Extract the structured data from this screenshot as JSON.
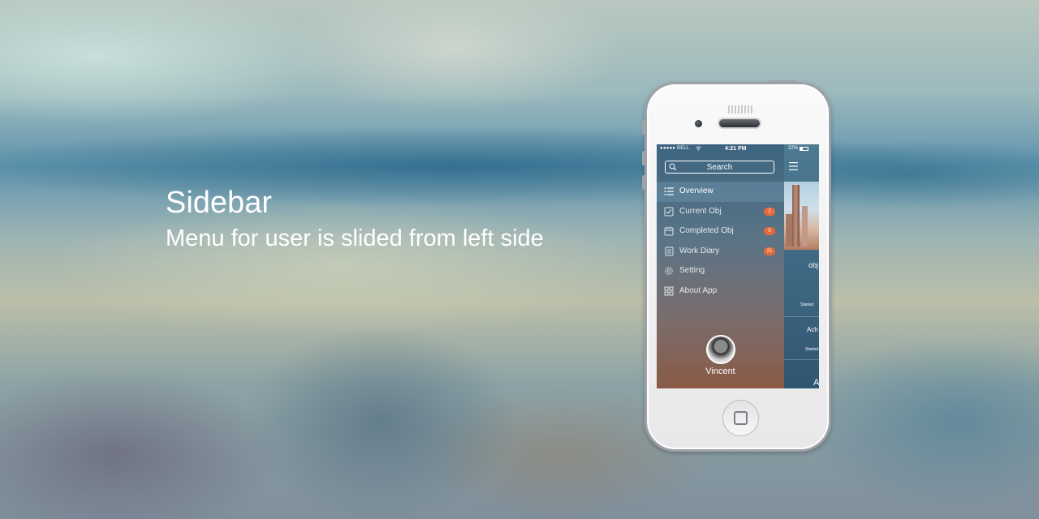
{
  "caption": {
    "title": "Sidebar",
    "subtitle": "Menu for user is slided from left side"
  },
  "status_bar": {
    "carrier": "●●●●● BELL",
    "time": "4:21 PM",
    "battery": "22%"
  },
  "search": {
    "label": "Search"
  },
  "menu": {
    "items": [
      {
        "label": "Overview",
        "icon": "list-icon",
        "active": true
      },
      {
        "label": "Current Obj",
        "icon": "checklist-icon",
        "badge": "2"
      },
      {
        "label": "Completed Obj",
        "icon": "calendar-icon",
        "badge": "0"
      },
      {
        "label": "Work Diary",
        "icon": "notebook-icon",
        "badge": "21"
      },
      {
        "label": "Setting",
        "icon": "gear-icon"
      },
      {
        "label": "About App",
        "icon": "grid-icon"
      }
    ]
  },
  "user": {
    "name": "Vincent"
  },
  "main_panel": {
    "text_1": "obj",
    "text_2": "Started",
    "text_3": "Ach",
    "text_4": "Started",
    "text_5": "A"
  },
  "colors": {
    "badge": "#e8693a",
    "active_row": "#6e96af"
  }
}
